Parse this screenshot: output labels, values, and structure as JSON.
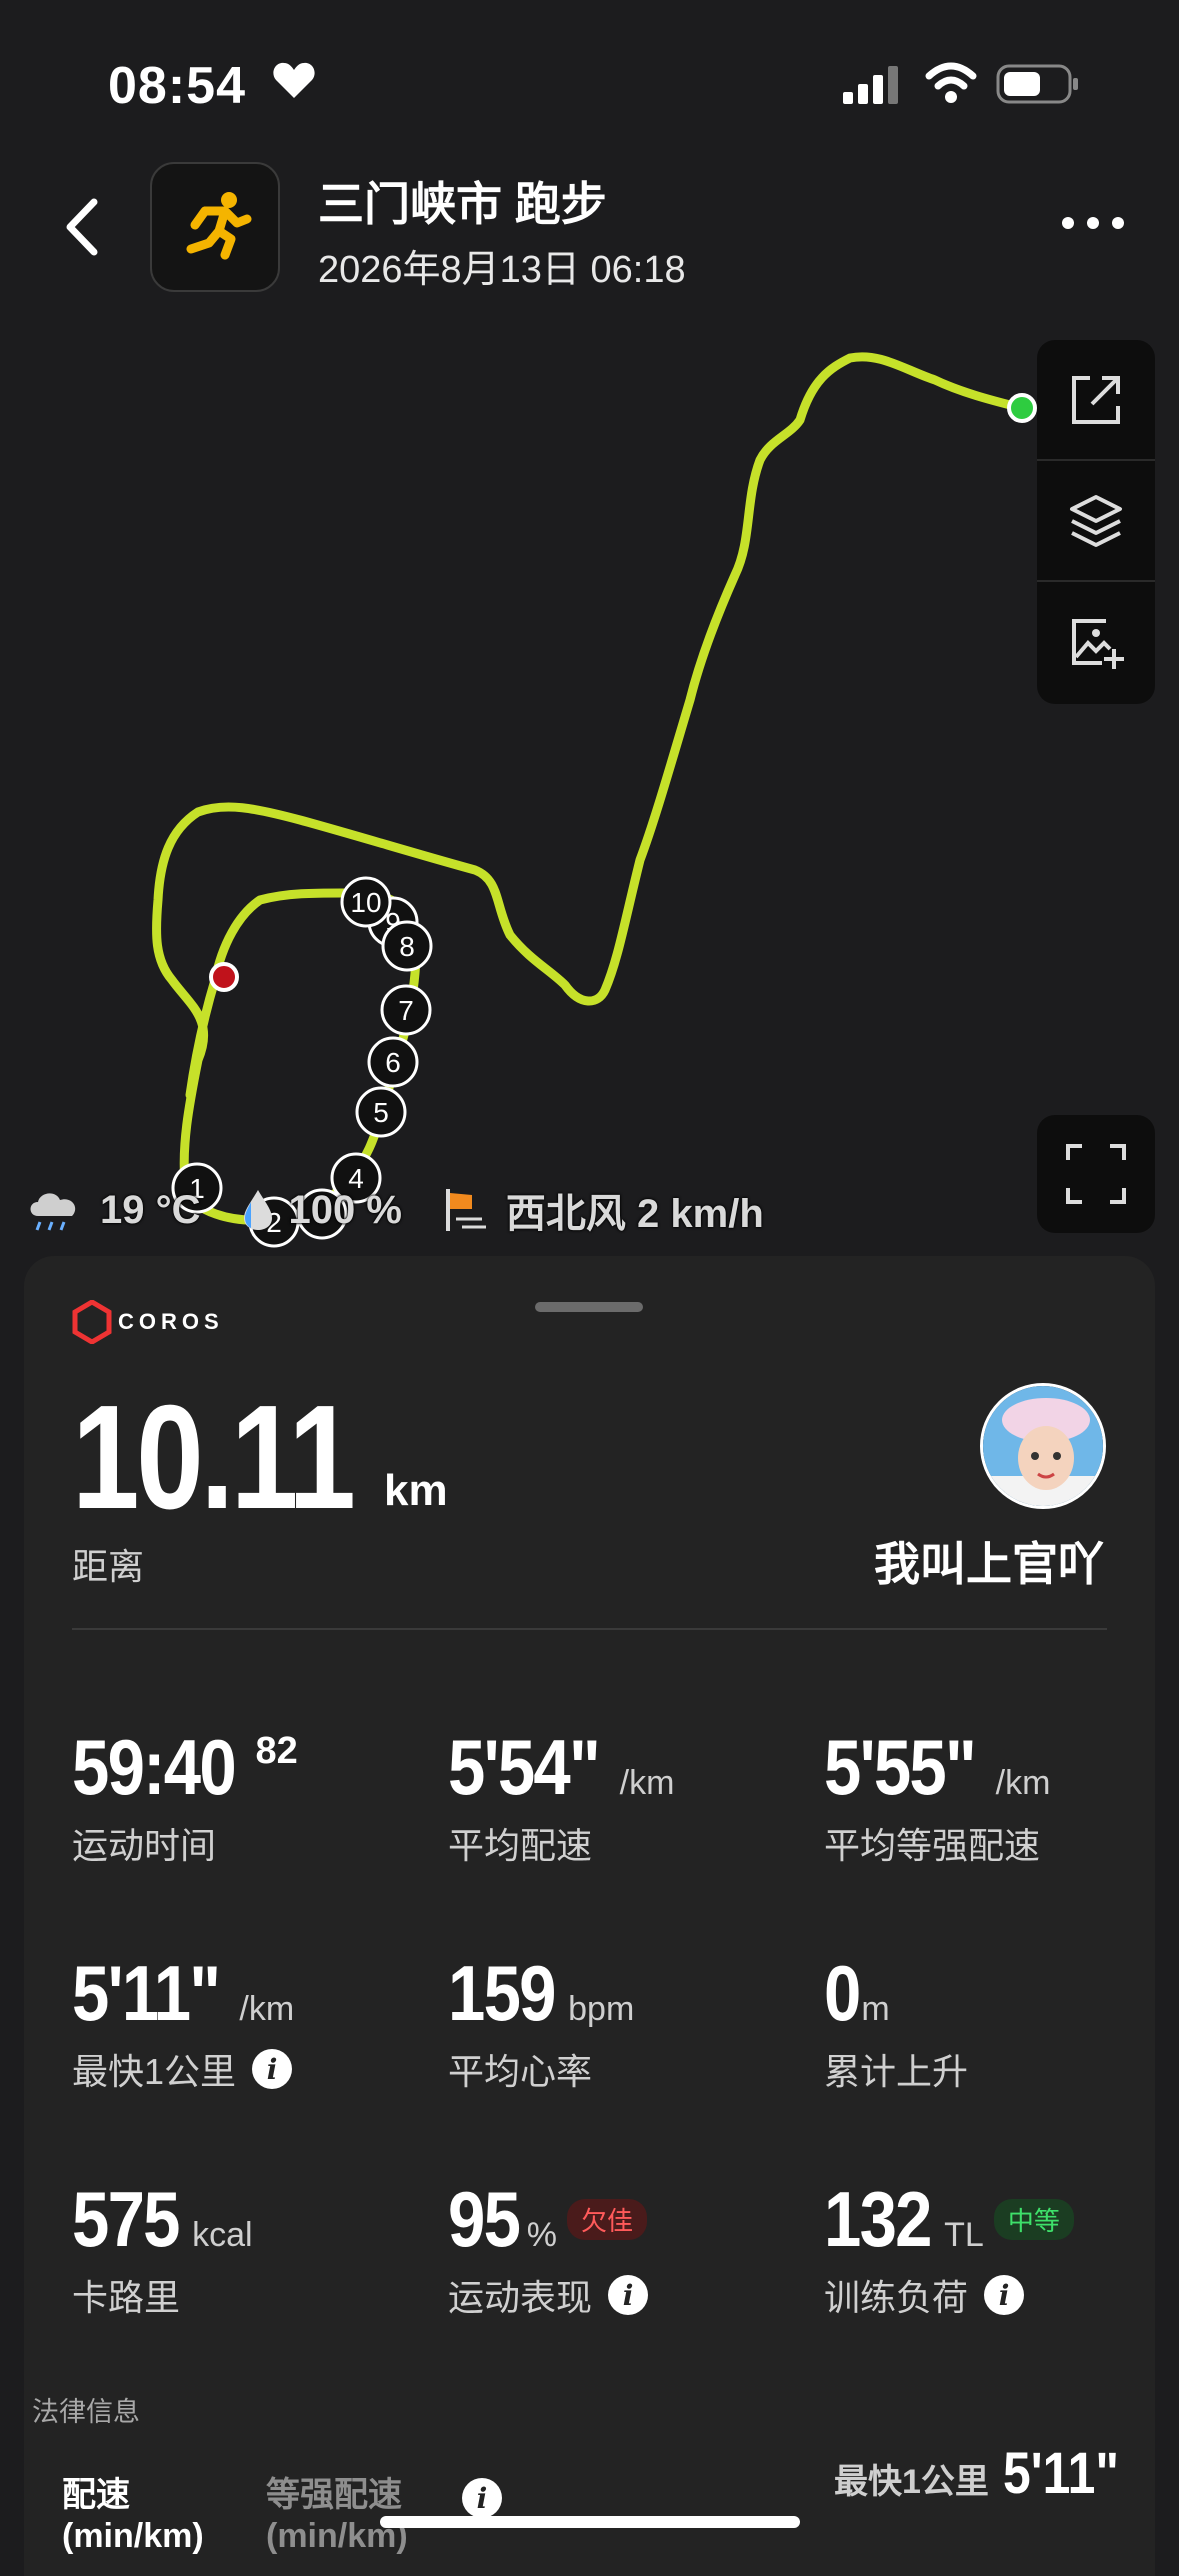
{
  "status_bar": {
    "time": "08:54"
  },
  "header": {
    "title": "三门峡市 跑步",
    "subtitle": "2026年8月13日 06:18"
  },
  "map": {
    "route_color": "#c6e12a",
    "start_color": "#2ecc40",
    "end_color": "#c0121b",
    "km_markers": [
      "1",
      "2",
      "4",
      "5",
      "6",
      "7",
      "8",
      "9",
      "10"
    ]
  },
  "weather": {
    "temperature": "19 °C",
    "humidity": "100 %",
    "wind": "西北风 2 km/h"
  },
  "summary": {
    "brand": "COROS",
    "distance_value": "10.11",
    "distance_unit": "km",
    "distance_label": "距离",
    "username": "我叫上官吖"
  },
  "stats": {
    "duration": {
      "value": "59:40",
      "sup": "82",
      "label": "运动时间"
    },
    "avg_pace": {
      "value": "5'54\"",
      "unit": "/km",
      "label": "平均配速"
    },
    "avg_eq_pace": {
      "value": "5'55\"",
      "unit": "/km",
      "label": "平均等强配速"
    },
    "fastest_km": {
      "value": "5'11\"",
      "unit": "/km",
      "label": "最快1公里"
    },
    "avg_hr": {
      "value": "159",
      "unit": "bpm",
      "label": "平均心率"
    },
    "ascent": {
      "value": "0",
      "unit": "m",
      "label": "累计上升"
    },
    "calories": {
      "value": "575",
      "unit": "kcal",
      "label": "卡路里"
    },
    "performance": {
      "value": "95",
      "unit": "%",
      "badge": "欠佳",
      "label": "运动表现"
    },
    "training_load": {
      "value": "132",
      "unit": "TL",
      "badge": "中等",
      "label": "训练负荷"
    }
  },
  "footer": {
    "legal": "法律信息",
    "tab_pace_line1": "配速",
    "tab_pace_line2": "(min/km)",
    "tab_gap_line1": "等强配速",
    "tab_gap_line2": "(min/km)",
    "fastest_label": "最快1公里",
    "fastest_value": "5'11\""
  }
}
